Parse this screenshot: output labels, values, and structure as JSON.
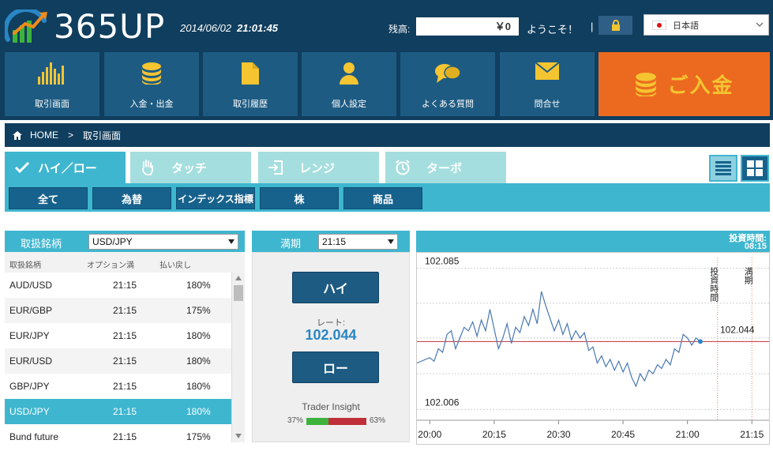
{
  "header": {
    "logo_text": "365UP",
    "date": "2014/06/02",
    "time": "21:01:45",
    "balance_label": "残高:",
    "balance_value": "￥0",
    "welcome": "ようこそ！",
    "separator": "|",
    "language": "日本語"
  },
  "nav": [
    {
      "label": "取引画面",
      "icon": "bar-chart-icon"
    },
    {
      "label": "入金・出金",
      "icon": "coin-stack-icon"
    },
    {
      "label": "取引履歴",
      "icon": "document-icon"
    },
    {
      "label": "個人設定",
      "icon": "person-icon"
    },
    {
      "label": "よくある質問",
      "icon": "chat-bubbles-icon"
    },
    {
      "label": "問合せ",
      "icon": "envelope-icon"
    }
  ],
  "deposit_label": "ご入金",
  "breadcrumb": {
    "home": "HOME",
    "separator": ">",
    "current": "取引画面"
  },
  "tabs": [
    {
      "label": "ハイ／ロー",
      "icon": "checkmark-icon",
      "active": true
    },
    {
      "label": "タッチ",
      "icon": "hand-icon",
      "active": false
    },
    {
      "label": "レンジ",
      "icon": "enter-icon",
      "active": false
    },
    {
      "label": "ターボ",
      "icon": "alarm-clock-icon",
      "active": false
    }
  ],
  "subtabs": [
    "全て",
    "為替",
    "インデックス指標",
    "株",
    "商品"
  ],
  "asset_panel": {
    "label": "取扱銘柄",
    "selected": "USD/JPY",
    "columns": [
      "取扱銘柄",
      "オプション満",
      "払い戻し"
    ],
    "rows": [
      {
        "asset": "AUD/USD",
        "expiry": "21:15",
        "payout": "180%"
      },
      {
        "asset": "EUR/GBP",
        "expiry": "21:15",
        "payout": "175%"
      },
      {
        "asset": "EUR/JPY",
        "expiry": "21:15",
        "payout": "180%"
      },
      {
        "asset": "EUR/USD",
        "expiry": "21:15",
        "payout": "180%"
      },
      {
        "asset": "GBP/JPY",
        "expiry": "21:15",
        "payout": "180%"
      },
      {
        "asset": "USD/JPY",
        "expiry": "21:15",
        "payout": "180%"
      },
      {
        "asset": "Bund future",
        "expiry": "21:15",
        "payout": "175%"
      }
    ],
    "selected_index": 5
  },
  "trade_panel": {
    "expiry_label": "満期",
    "expiry_value": "21:15",
    "high_label": "ハイ",
    "rate_label": "レート:",
    "rate_value": "102.044",
    "low_label": "ロー",
    "insight_label": "Trader Insight",
    "insight_low_pct": "37%",
    "insight_high_pct": "63%",
    "insight_low_value": 37,
    "insight_high_value": 63
  },
  "chart_head": {
    "label": "投資時間:",
    "value": "08:15"
  },
  "chart_data": {
    "type": "line",
    "ylabel_top": "102.085",
    "ylabel_bottom": "102.006",
    "current_label": "102.044",
    "x_ticks": [
      "20:00",
      "20:15",
      "20:30",
      "20:45",
      "21:00",
      "21:15"
    ],
    "x_tick_minutes": [
      0,
      15,
      30,
      45,
      60,
      75
    ],
    "ylim": [
      102.0,
      102.091
    ],
    "xlim": [
      -3,
      79
    ],
    "current_value": 102.044,
    "vertical_markers": [
      {
        "label": "投資時間",
        "minute": 67
      },
      {
        "label": "満期",
        "minute": 75
      }
    ],
    "series": [
      {
        "values": [
          [
            -3,
            102.032
          ],
          [
            -1,
            102.034
          ],
          [
            0,
            102.035
          ],
          [
            1,
            102.033
          ],
          [
            2,
            102.04
          ],
          [
            3,
            102.038
          ],
          [
            4,
            102.048
          ],
          [
            5,
            102.05
          ],
          [
            6,
            102.04
          ],
          [
            7,
            102.046
          ],
          [
            8,
            102.052
          ],
          [
            9,
            102.05
          ],
          [
            10,
            102.055
          ],
          [
            11,
            102.047
          ],
          [
            12,
            102.056
          ],
          [
            13,
            102.05
          ],
          [
            14,
            102.062
          ],
          [
            15,
            102.051
          ],
          [
            16,
            102.04
          ],
          [
            17,
            102.046
          ],
          [
            18,
            102.054
          ],
          [
            19,
            102.043
          ],
          [
            20,
            102.052
          ],
          [
            21,
            102.049
          ],
          [
            22,
            102.058
          ],
          [
            23,
            102.053
          ],
          [
            24,
            102.062
          ],
          [
            25,
            102.054
          ],
          [
            26,
            102.072
          ],
          [
            27,
            102.064
          ],
          [
            28,
            102.057
          ],
          [
            29,
            102.05
          ],
          [
            30,
            102.056
          ],
          [
            31,
            102.048
          ],
          [
            32,
            102.054
          ],
          [
            33,
            102.045
          ],
          [
            34,
            102.05
          ],
          [
            35,
            102.046
          ],
          [
            36,
            102.049
          ],
          [
            37,
            102.039
          ],
          [
            38,
            102.041
          ],
          [
            39,
            102.032
          ],
          [
            40,
            102.036
          ],
          [
            41,
            102.03
          ],
          [
            42,
            102.034
          ],
          [
            43,
            102.028
          ],
          [
            44,
            102.033
          ],
          [
            45,
            102.027
          ],
          [
            46,
            102.032
          ],
          [
            47,
            102.024
          ],
          [
            48,
            102.019
          ],
          [
            49,
            102.026
          ],
          [
            50,
            102.022
          ],
          [
            51,
            102.028
          ],
          [
            52,
            102.026
          ],
          [
            53,
            102.031
          ],
          [
            54,
            102.029
          ],
          [
            55,
            102.034
          ],
          [
            56,
            102.031
          ],
          [
            57,
            102.04
          ],
          [
            58,
            102.038
          ],
          [
            59,
            102.048
          ],
          [
            60,
            102.046
          ],
          [
            61,
            102.042
          ],
          [
            62,
            102.046
          ],
          [
            63,
            102.044
          ]
        ]
      }
    ]
  },
  "colors": {
    "header_bg": "#103e5e",
    "tile_bg": "#1e5b82",
    "deposit_bg": "#ec6a1f",
    "accent": "#3fb6cf",
    "tab_inactive": "#a5dede",
    "icon_yellow": "#f4c531",
    "chart_line": "#4a78b0",
    "current_line": "#c0303a"
  }
}
